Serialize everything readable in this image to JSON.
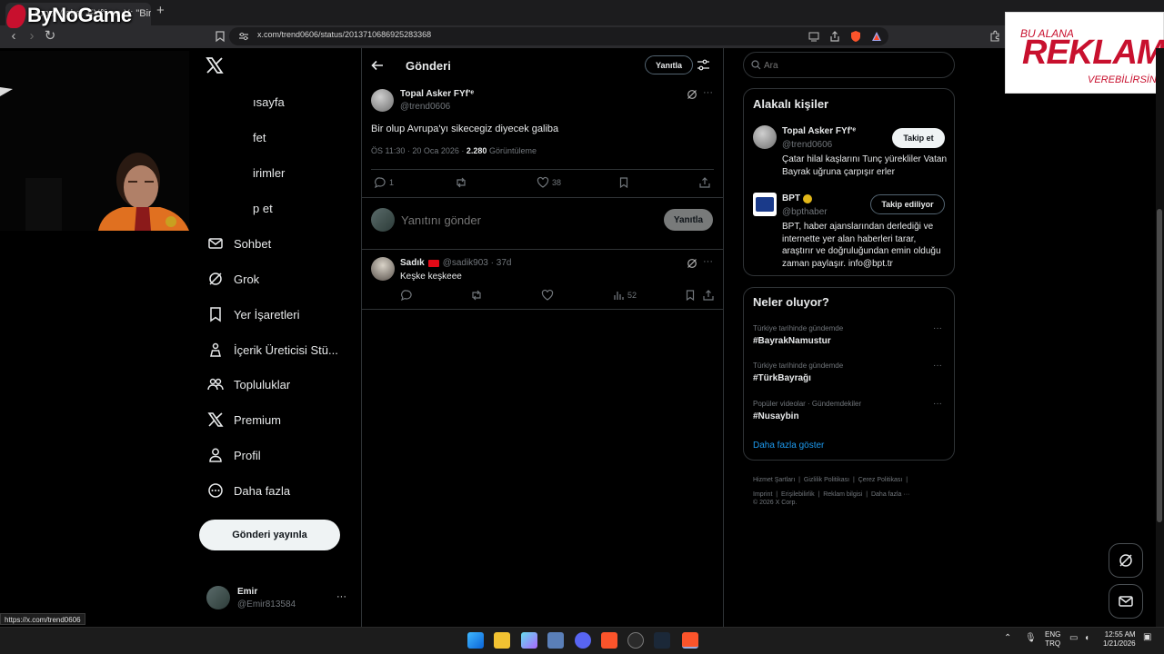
{
  "watermark": {
    "brand": "ByNoGame",
    "ad_top": "BU ALANA",
    "ad_big": "REKLAM",
    "ad_sub": "VEREBİLİRSİNİZ"
  },
  "browser": {
    "tab_title": "Topal Asker FYf'i on X: \"Bir o",
    "new_tab": "+",
    "url": "x.com/trend0606/status/2013710686925283368",
    "status_url": "https://x.com/trend0606"
  },
  "nav": {
    "items": [
      {
        "label": "Anasayfa",
        "shown": "ısayfa"
      },
      {
        "label": "Keşfet",
        "shown": "fet"
      },
      {
        "label": "Bildirimler",
        "shown": "irimler"
      },
      {
        "label": "Takip et",
        "shown": "p et"
      },
      {
        "label": "Sohbet"
      },
      {
        "label": "Grok"
      },
      {
        "label": "Yer İşaretleri"
      },
      {
        "label": "İçerik Üreticisi Stü..."
      },
      {
        "label": "Topluluklar"
      },
      {
        "label": "Premium"
      },
      {
        "label": "Profil"
      },
      {
        "label": "Daha fazla"
      }
    ],
    "post_button": "Gönderi yayınla",
    "account": {
      "name": "Emir",
      "handle": "@Emir813584",
      "more": "···"
    }
  },
  "header": {
    "title": "Gönderi",
    "reply_button": "Yanıtla"
  },
  "post": {
    "author": "Topal Asker FYf'ᵉ",
    "handle": "@trend0606",
    "text": "Bir olup Avrupa'yı sikecegiz diyecek galiba",
    "time": "ÖS 11:30 · 20 Oca 2026 · ",
    "views": "2.280",
    "views_label": "Görüntüleme",
    "replies": "1",
    "likes": "38",
    "more": "···"
  },
  "composer": {
    "placeholder": "Yanıtını gönder",
    "button": "Yanıtla"
  },
  "reply": {
    "author": "Sadık",
    "meta": "@sadik903 · 37d",
    "text": "Keşke keşkeee",
    "views": "52",
    "more": "···"
  },
  "sidebar": {
    "search_placeholder": "Ara",
    "people_title": "Alakalı kişiler",
    "people": [
      {
        "name": "Topal Asker FYf'ᵉ",
        "handle": "@trend0606",
        "bio": "Çatar hilal kaşlarını Tunç yürekliler Vatan Bayrak uğruna çarpışır erler",
        "button": "Takip et"
      },
      {
        "name": "BPT",
        "handle": "@bpthaber",
        "bio": "BPT, haber ajanslarından derlediği ve internette yer alan haberleri tarar, araştırır ve doğruluğundan emin olduğu zaman paylaşır. info@bpt.tr",
        "button": "Takip ediliyor"
      }
    ],
    "trends_title": "Neler oluyor?",
    "trends": [
      {
        "context": "Türkiye tarihinde gündemde",
        "name": "#BayrakNamustur"
      },
      {
        "context": "Türkiye tarihinde gündemde",
        "name": "#TürkBayrağı"
      },
      {
        "context": "Popüler videolar · Gündemdekiler",
        "name": "#Nusaybin"
      }
    ],
    "show_more": "Daha fazla göster",
    "footer": [
      "Hizmet Şartları",
      "Gizlilik Politikası",
      "Çerez Politikası",
      "Imprint",
      "Erişilebilirlik",
      "Reklam bilgisi",
      "Daha fazla ···",
      "© 2026 X Corp."
    ]
  },
  "taskbar": {
    "lang1": "ENG",
    "lang2": "TRQ",
    "time": "12:55 AM",
    "date": "1/21/2026"
  },
  "colors": {
    "accent": "#1d9bf0",
    "border": "#2f3336",
    "muted": "#71767b",
    "ad_red": "#c8102e"
  }
}
